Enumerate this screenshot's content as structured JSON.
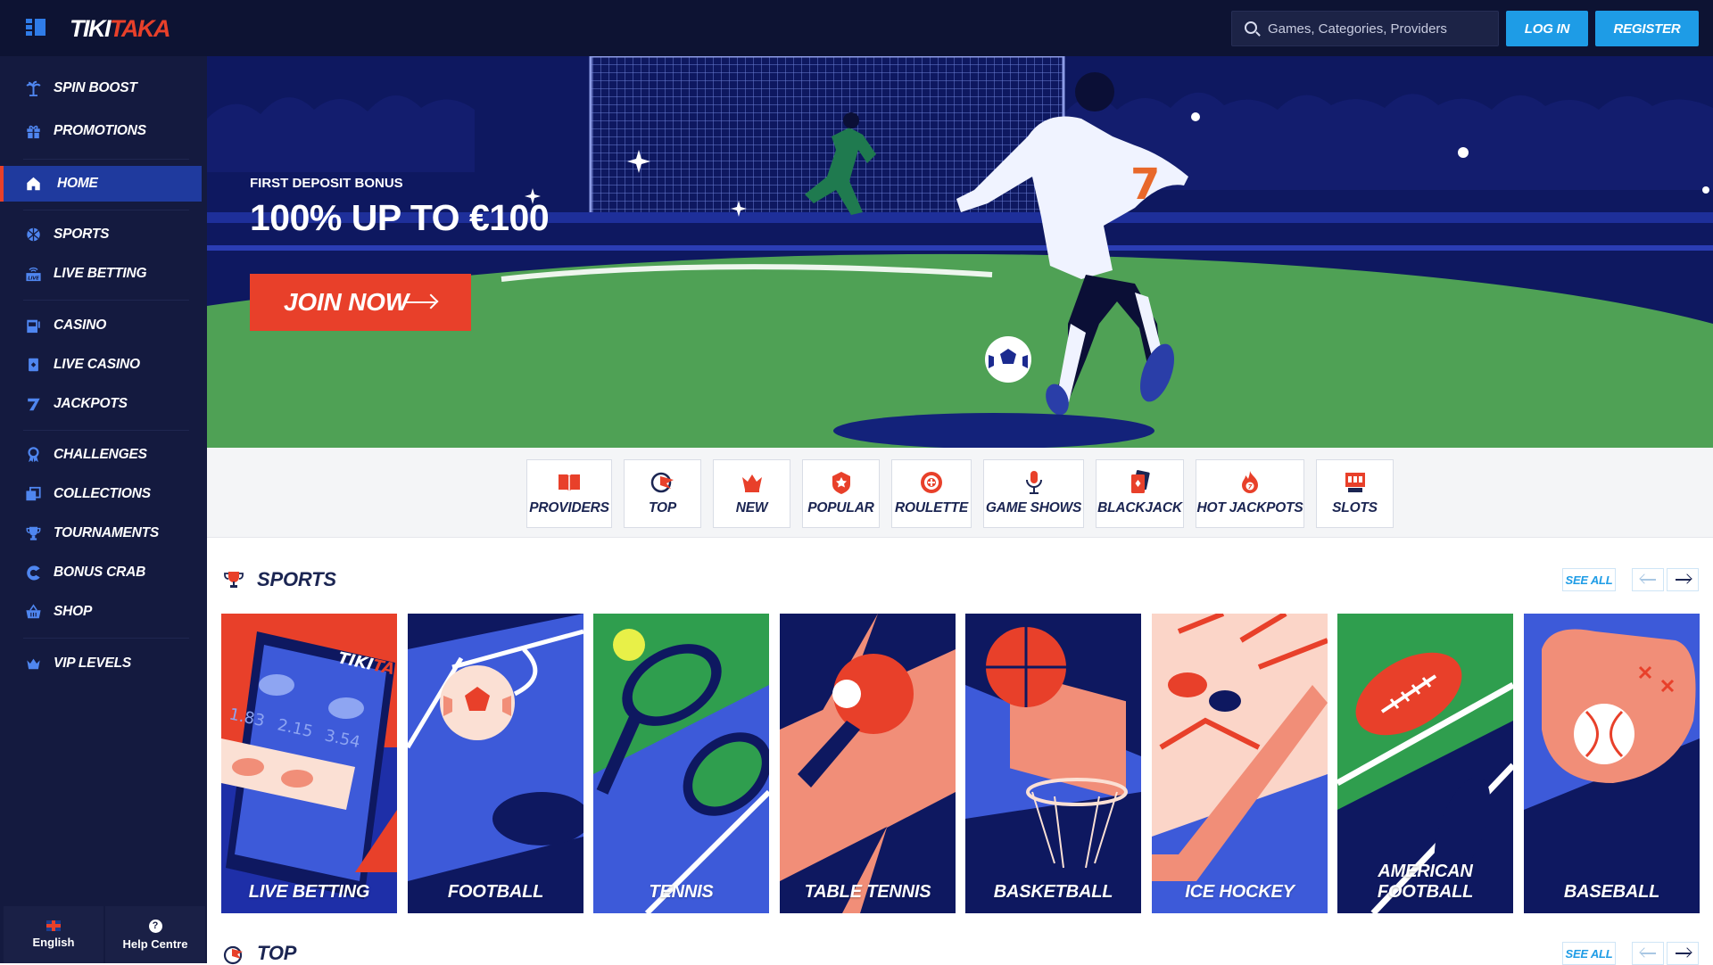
{
  "brand": {
    "logo_a": "TIKI",
    "logo_b": "TAKA",
    "accent": "#e8402a",
    "primary": "#1e9ce6",
    "navy": "#141a3f"
  },
  "header": {
    "search_placeholder": "Games, Categories, Providers",
    "login_label": "LOG IN",
    "register_label": "REGISTER"
  },
  "sidebar": {
    "items": [
      {
        "label": "SPIN BOOST",
        "icon": "palm-icon"
      },
      {
        "label": "PROMOTIONS",
        "icon": "gift-icon"
      },
      {
        "label": "HOME",
        "icon": "home-icon",
        "active": true
      },
      {
        "label": "SPORTS",
        "icon": "ball-icon"
      },
      {
        "label": "LIVE BETTING",
        "icon": "live-icon"
      },
      {
        "label": "CASINO",
        "icon": "slot-machine-icon"
      },
      {
        "label": "LIVE CASINO",
        "icon": "cards-icon"
      },
      {
        "label": "JACKPOTS",
        "icon": "seven-icon"
      },
      {
        "label": "CHALLENGES",
        "icon": "medal-icon"
      },
      {
        "label": "COLLECTIONS",
        "icon": "collection-icon"
      },
      {
        "label": "TOURNAMENTS",
        "icon": "trophy-icon"
      },
      {
        "label": "BONUS CRAB",
        "icon": "claw-icon"
      },
      {
        "label": "SHOP",
        "icon": "basket-icon"
      },
      {
        "label": "VIP LEVELS",
        "icon": "crown-icon"
      }
    ],
    "footer": {
      "language": "English",
      "help": "Help Centre"
    }
  },
  "hero": {
    "tag": "FIRST DEPOSIT BONUS",
    "title": "100% UP TO €100",
    "cta": "JOIN NOW"
  },
  "categories": [
    {
      "label": "PROVIDERS",
      "icon": "book-icon"
    },
    {
      "label": "TOP",
      "icon": "flag-icon"
    },
    {
      "label": "NEW",
      "icon": "crown-icon"
    },
    {
      "label": "POPULAR",
      "icon": "star-badge-icon"
    },
    {
      "label": "ROULETTE",
      "icon": "roulette-icon"
    },
    {
      "label": "GAME SHOWS",
      "icon": "microphone-icon"
    },
    {
      "label": "BLACKJACK",
      "icon": "playing-card-icon"
    },
    {
      "label": "HOT JACKPOTS",
      "icon": "fire-icon"
    },
    {
      "label": "SLOTS",
      "icon": "slot-icon"
    }
  ],
  "sports_section": {
    "title": "SPORTS",
    "see_all": "SEE ALL",
    "tiles": [
      {
        "label": "LIVE BETTING",
        "odds": [
          "1.83",
          "2.15",
          "3.54"
        ]
      },
      {
        "label": "FOOTBALL"
      },
      {
        "label": "TENNIS"
      },
      {
        "label": "TABLE TENNIS"
      },
      {
        "label": "BASKETBALL"
      },
      {
        "label": "ICE HOCKEY"
      },
      {
        "label": "AMERICAN FOOTBALL"
      },
      {
        "label": "BASEBALL"
      }
    ]
  },
  "top_section": {
    "title": "TOP",
    "see_all": "SEE ALL"
  }
}
